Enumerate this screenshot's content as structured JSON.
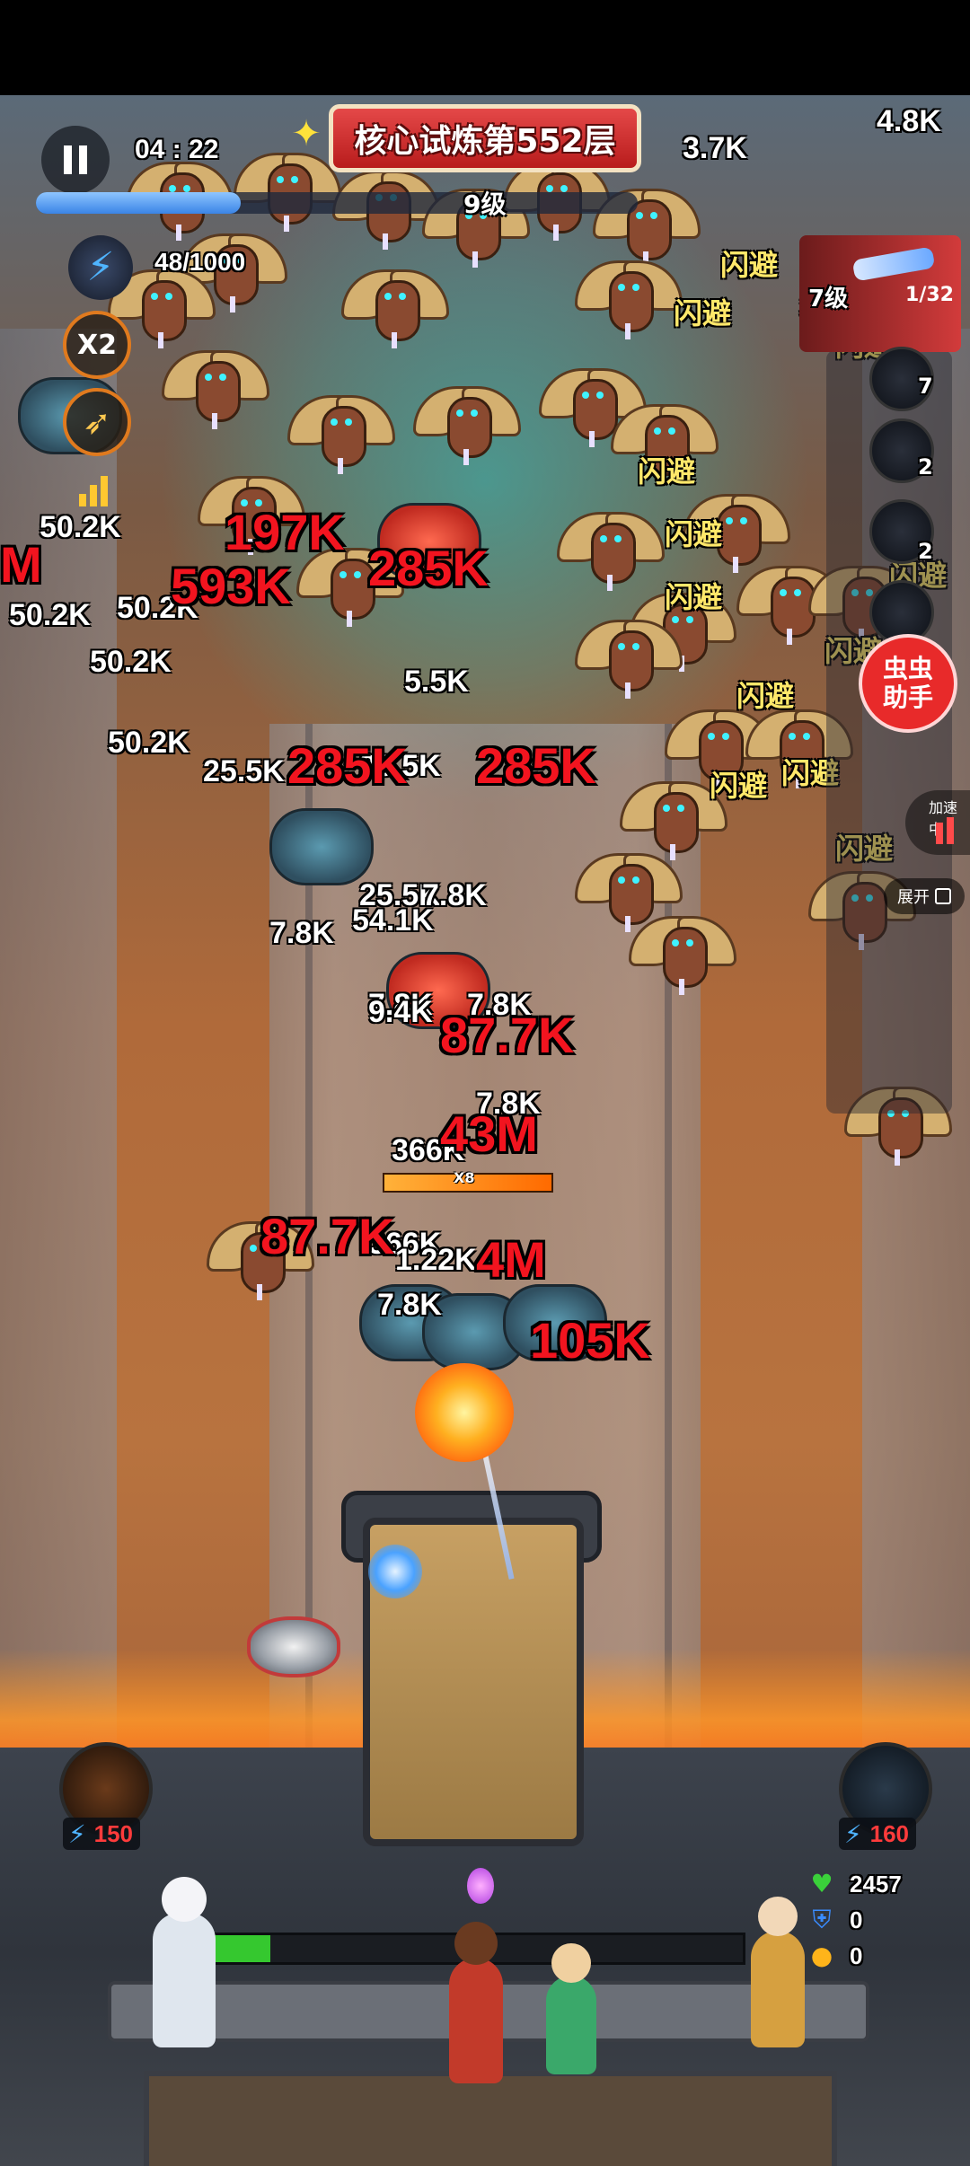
{
  "hud": {
    "timer": "04 : 22",
    "stage_title": "核心试炼第552层",
    "level_label": "9级",
    "xp_fraction": 0.34,
    "energy": "48/1000",
    "multiplier": "X2",
    "skill_panel": {
      "level": "7级",
      "progress": "1/32"
    },
    "side_slots": [
      "7",
      "2",
      "2"
    ],
    "helper": {
      "line1": "虫虫",
      "line2": "助手"
    },
    "speed_label": "加速中",
    "expand_label": "展开",
    "boss_multiplier": "X8",
    "boss_hp_fraction": 1.0
  },
  "skills": {
    "left_cost": "150",
    "right_cost": "160"
  },
  "stats": {
    "health": "2457",
    "shield": "0",
    "gold": "0"
  },
  "base_hp_fraction": 0.18,
  "icons": {
    "pause": "pause-icon",
    "energy": "lightning-icon",
    "bullet": "bullet-icon",
    "bars": "bar-chart-icon",
    "sparkle": "sparkle-icon",
    "heart": "heart-icon",
    "shield": "shield-icon",
    "coin": "coin-icon"
  },
  "colors": {
    "damage_red": "#f2141f",
    "dodge_yellow": "#ffe86a",
    "xp_blue": "#3a84e6",
    "base_hp_green": "#35c82f",
    "cost_red": "#ff3b3b"
  },
  "dodge_text": "闪避",
  "damage_numbers": {
    "white": [
      "4.8K",
      "3.7K",
      "3.7K",
      "50.2K",
      "50.2K",
      "50.2K",
      "50.2K",
      "50.2K",
      "25.5K",
      "25.5K",
      "25.5K",
      "5.5K",
      "7.8K",
      "7.8K",
      "7.8K",
      "7.8K",
      "7.8K",
      "9.4K",
      "366K",
      "366K",
      "1.22K",
      "7.8K",
      "54.1K"
    ],
    "red": [
      "197K",
      "593K",
      "285K",
      "285K",
      "285K",
      "87.7K",
      "87.7K",
      "43M",
      "4M",
      "105K",
      "M"
    ]
  }
}
